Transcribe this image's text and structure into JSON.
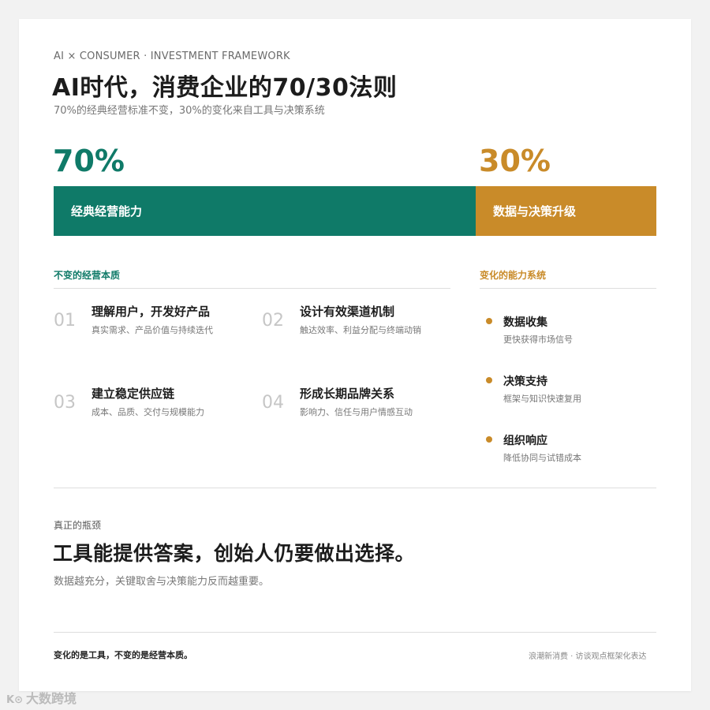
{
  "header": {
    "eyebrow": "AI × CONSUMER · INVESTMENT FRAMEWORK",
    "title": "AI时代，消费企业的70/30法则",
    "subtitle": "70%的经典经营标准不变，30%的变化来自工具与决策系统"
  },
  "split": {
    "left_pct": "70%",
    "right_pct": "30%",
    "left_label": "经典经营能力",
    "right_label": "数据与决策升级",
    "left_share": 0.7,
    "right_share": 0.3
  },
  "unchanged": {
    "heading": "不变的经营本质",
    "items": [
      {
        "num": "01",
        "title": "理解用户，开发好产品",
        "desc": "真实需求、产品价值与持续迭代"
      },
      {
        "num": "02",
        "title": "设计有效渠道机制",
        "desc": "触达效率、利益分配与终端动销"
      },
      {
        "num": "03",
        "title": "建立稳定供应链",
        "desc": "成本、品质、交付与规模能力"
      },
      {
        "num": "04",
        "title": "形成长期品牌关系",
        "desc": "影响力、信任与用户情感互动"
      }
    ]
  },
  "changed": {
    "heading": "变化的能力系统",
    "items": [
      {
        "title": "数据收集",
        "desc": "更快获得市场信号"
      },
      {
        "title": "决策支持",
        "desc": "框架与知识快速复用"
      },
      {
        "title": "组织响应",
        "desc": "降低协同与试错成本"
      }
    ]
  },
  "bottleneck": {
    "label": "真正的瓶颈",
    "title": "工具能提供答案，创始人仍要做出选择。",
    "desc": "数据越充分，关键取舍与决策能力反而越重要。"
  },
  "footer": {
    "left": "变化的是工具，不变的是经营本质。",
    "right": "浪潮新消费 · 访谈观点框架化表达"
  },
  "watermark": {
    "logo": "K⊙",
    "text": "大数跨境"
  },
  "colors": {
    "green": "#0f7a68",
    "gold": "#c98b29"
  }
}
